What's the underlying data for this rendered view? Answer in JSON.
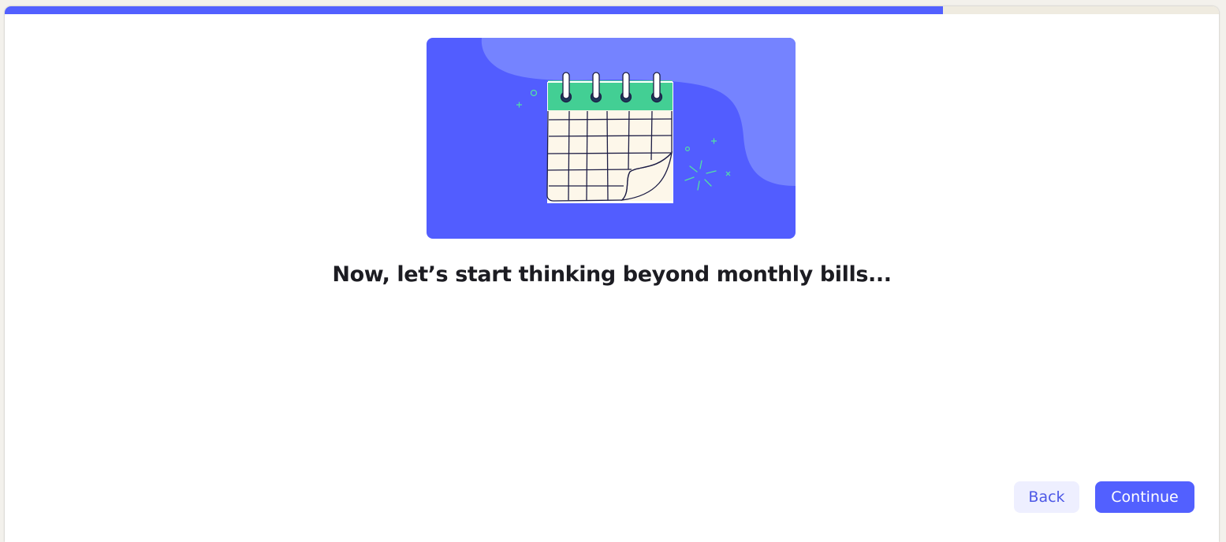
{
  "progress": {
    "fraction": 0.773
  },
  "illustration": {
    "icon": "calendar-icon",
    "background_color": "#525dff",
    "blob_color": "#7583ff",
    "calendar_header_color": "#43cf94",
    "calendar_paper_color": "#fdf7ea",
    "sparkle_color": "#52e0a4"
  },
  "content": {
    "headline": "Now, let’s start thinking beyond monthly bills..."
  },
  "footer": {
    "back_label": "Back",
    "continue_label": "Continue"
  },
  "colors": {
    "accent": "#5260ff",
    "progress_track": "#efebe0",
    "back_button_bg": "#eeefff"
  }
}
